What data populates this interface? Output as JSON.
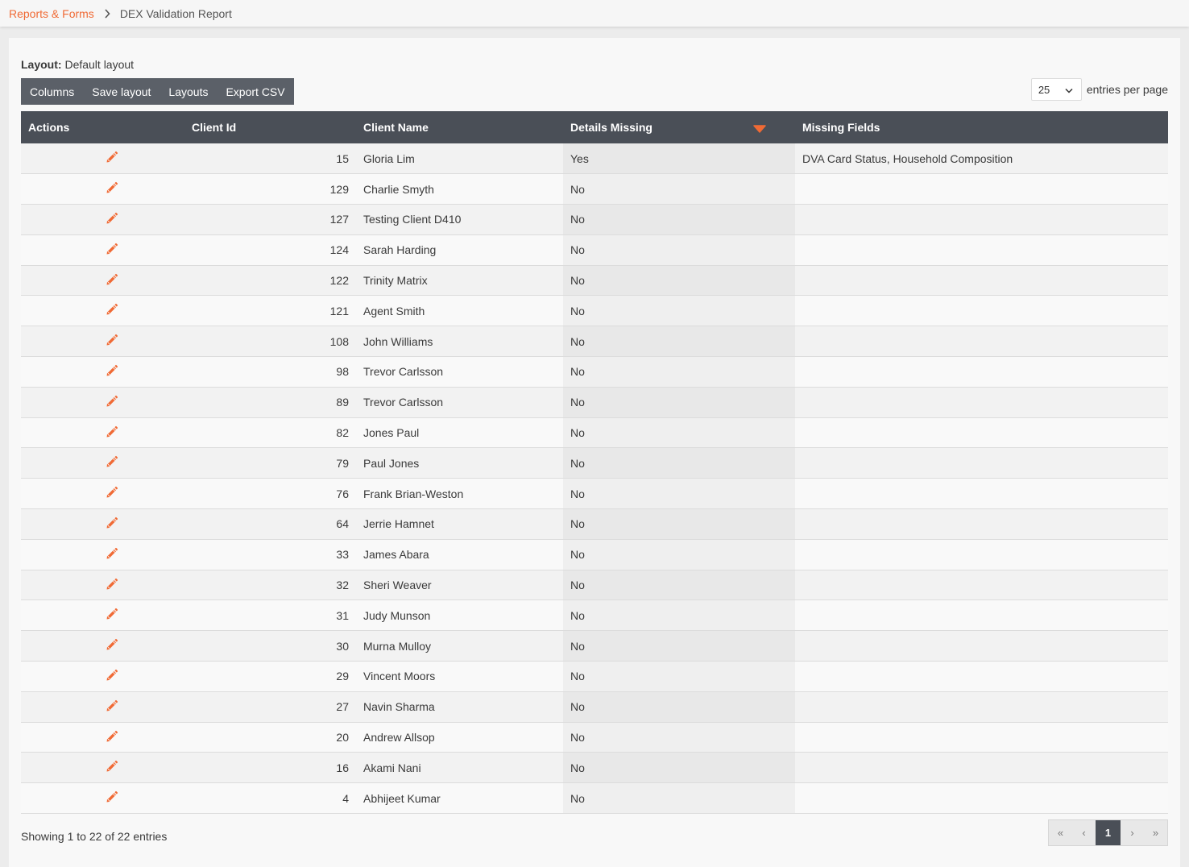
{
  "breadcrumb": {
    "parent": "Reports & Forms",
    "current": "DEX Validation Report"
  },
  "layout": {
    "label": "Layout:",
    "value": "Default layout"
  },
  "toolbar": {
    "columns": "Columns",
    "save_layout": "Save layout",
    "layouts": "Layouts",
    "export_csv": "Export CSV"
  },
  "per_page": {
    "value": "25",
    "label": "entries per page"
  },
  "table": {
    "headers": [
      "Actions",
      "Client Id",
      "Client Name",
      "Details Missing",
      "Missing Fields"
    ],
    "sorted_column": "Details Missing",
    "rows": [
      {
        "id": "15",
        "name": "Gloria Lim",
        "missing": "Yes",
        "fields": "DVA Card Status, Household Composition"
      },
      {
        "id": "129",
        "name": "Charlie Smyth",
        "missing": "No",
        "fields": ""
      },
      {
        "id": "127",
        "name": "Testing Client D410",
        "missing": "No",
        "fields": ""
      },
      {
        "id": "124",
        "name": "Sarah Harding",
        "missing": "No",
        "fields": ""
      },
      {
        "id": "122",
        "name": "Trinity Matrix",
        "missing": "No",
        "fields": ""
      },
      {
        "id": "121",
        "name": "Agent Smith",
        "missing": "No",
        "fields": ""
      },
      {
        "id": "108",
        "name": "John Williams",
        "missing": "No",
        "fields": ""
      },
      {
        "id": "98",
        "name": "Trevor Carlsson",
        "missing": "No",
        "fields": ""
      },
      {
        "id": "89",
        "name": "Trevor Carlsson",
        "missing": "No",
        "fields": ""
      },
      {
        "id": "82",
        "name": "Jones Paul",
        "missing": "No",
        "fields": ""
      },
      {
        "id": "79",
        "name": "Paul Jones",
        "missing": "No",
        "fields": ""
      },
      {
        "id": "76",
        "name": "Frank Brian-Weston",
        "missing": "No",
        "fields": ""
      },
      {
        "id": "64",
        "name": "Jerrie Hamnet",
        "missing": "No",
        "fields": ""
      },
      {
        "id": "33",
        "name": "James Abara",
        "missing": "No",
        "fields": ""
      },
      {
        "id": "32",
        "name": "Sheri Weaver",
        "missing": "No",
        "fields": ""
      },
      {
        "id": "31",
        "name": "Judy Munson",
        "missing": "No",
        "fields": ""
      },
      {
        "id": "30",
        "name": "Murna Mulloy",
        "missing": "No",
        "fields": ""
      },
      {
        "id": "29",
        "name": "Vincent Moors",
        "missing": "No",
        "fields": ""
      },
      {
        "id": "27",
        "name": "Navin Sharma",
        "missing": "No",
        "fields": ""
      },
      {
        "id": "20",
        "name": "Andrew Allsop",
        "missing": "No",
        "fields": ""
      },
      {
        "id": "16",
        "name": "Akami Nani",
        "missing": "No",
        "fields": ""
      },
      {
        "id": "4",
        "name": "Abhijeet Kumar",
        "missing": "No",
        "fields": ""
      }
    ]
  },
  "footer": {
    "info": "Showing 1 to 22 of 22 entries"
  },
  "pagination": {
    "first": "«",
    "prev": "‹",
    "current": "1",
    "next": "›",
    "last": "»"
  },
  "colors": {
    "accent": "#f06a35",
    "header_bg": "#4a4f57",
    "toolbar_bg": "#5b6068"
  },
  "icons": {
    "row_action": "pencil-edit-icon",
    "sort": "caret-down-icon",
    "breadcrumb_separator": "chevron-right-icon",
    "select": "chevron-down-icon"
  }
}
